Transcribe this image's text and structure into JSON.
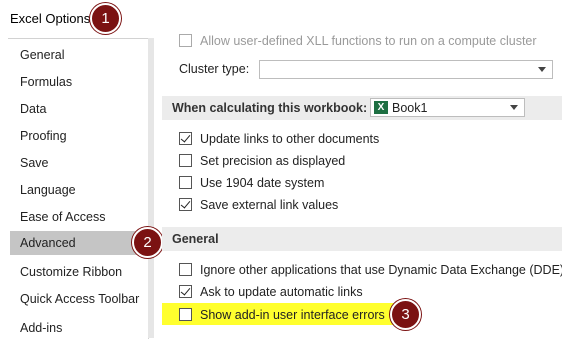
{
  "window": {
    "title": "Excel Options"
  },
  "badges": {
    "one": "1",
    "two": "2",
    "three": "3"
  },
  "sidebar": {
    "items": [
      {
        "label": "General"
      },
      {
        "label": "Formulas"
      },
      {
        "label": "Data"
      },
      {
        "label": "Proofing"
      },
      {
        "label": "Save"
      },
      {
        "label": "Language"
      },
      {
        "label": "Ease of Access"
      },
      {
        "label": "Advanced"
      },
      {
        "label": "Customize Ribbon"
      },
      {
        "label": "Quick Access Toolbar"
      },
      {
        "label": "Add-ins"
      }
    ],
    "selected": "Advanced"
  },
  "main": {
    "top_option": "Allow user-defined XLL functions to run on a compute cluster",
    "cluster_label": "Cluster type:",
    "cluster_value": "",
    "calc_section": {
      "label": "When calculating this workbook:",
      "workbook": "Book1"
    },
    "calc_options": [
      {
        "label": "Update links to other documents",
        "checked": true
      },
      {
        "label": "Set precision as displayed",
        "checked": false
      },
      {
        "label": "Use 1904 date system",
        "checked": false
      },
      {
        "label": "Save external link values",
        "checked": true
      }
    ],
    "general_section": {
      "label": "General"
    },
    "general_options": [
      {
        "label": "Ignore other applications that use Dynamic Data Exchange (DDE)",
        "checked": false
      },
      {
        "label": "Ask to update automatic links",
        "checked": true
      },
      {
        "label": "Show add-in user interface errors",
        "checked": false
      }
    ]
  },
  "colors": {
    "badge": "#7b1212",
    "highlight": "#ffff2e",
    "selected_bg": "#c5c5c5",
    "excel_green": "#1d6f42"
  }
}
